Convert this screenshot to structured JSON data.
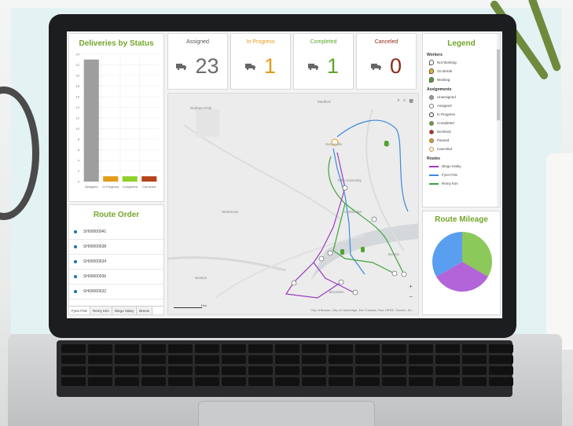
{
  "dashboard": {
    "deliveries_title": "Deliveries by Status",
    "route_order_title": "Route Order",
    "legend_title": "Legend",
    "route_mileage_title": "Route Mileage"
  },
  "stats": [
    {
      "label": "Assigned",
      "value": "23",
      "color": "#6b6b6b",
      "label_color": "#555555"
    },
    {
      "label": "In Progress",
      "value": "1",
      "color": "#e29b1b",
      "label_color": "#e29b1b"
    },
    {
      "label": "Completed",
      "value": "1",
      "color": "#5ea72c",
      "label_color": "#5ea72c"
    },
    {
      "label": "Canceled",
      "value": "0",
      "color": "#8e2b16",
      "label_color": "#8e2b16"
    }
  ],
  "route_order": {
    "items": [
      "SH00000941",
      "SH00000638",
      "SH00000634",
      "SH00000936",
      "SH00000632"
    ],
    "tabs": [
      "Fynn Fritz",
      "Remy Kim",
      "Diego Haley",
      "Breeis"
    ],
    "active_tab": 0
  },
  "legend": {
    "workers_heading": "Workers",
    "workers": [
      {
        "label": "Not Working",
        "color": "#ffffff"
      },
      {
        "label": "On Break",
        "color": "#e5b72a"
      },
      {
        "label": "Working",
        "color": "#4fa32c"
      }
    ],
    "assignments_heading": "Assignments",
    "assignments": [
      {
        "label": "Unassigned",
        "color": "#9a9a9a"
      },
      {
        "label": "Assigned",
        "color": "#ffffff"
      },
      {
        "label": "In Progress",
        "color": "#ffffff"
      },
      {
        "label": "Completed",
        "color": "#5ea72c"
      },
      {
        "label": "Declined",
        "color": "#c0251b"
      },
      {
        "label": "Paused",
        "color": "#e29b1b"
      },
      {
        "label": "Canceled",
        "color": "#ffffff"
      }
    ],
    "routes_heading": "Routes",
    "routes": [
      {
        "label": "Diego Haley",
        "color": "#9b3cc0"
      },
      {
        "label": "Fynn Fritz",
        "color": "#3b8ad9"
      },
      {
        "label": "Remy Kim",
        "color": "#3fa33f"
      }
    ]
  },
  "map": {
    "labels": [
      "Medford",
      "Somerville",
      "Cambridge",
      "Watertown",
      "Newton",
      "Boston",
      "Brookline",
      "Dedham Park",
      "Tufts University"
    ],
    "attribution": "City of Boston, City of Cambridge, Esri Canada, Esri, HERE, Garmin, Se...",
    "scale_label": "1km",
    "zoom_in": "+",
    "zoom_out": "−"
  },
  "chart_data": {
    "type": "bar",
    "title": "Deliveries by Status",
    "categories": [
      "Assigned",
      "In Progress",
      "Completed",
      "Canceled"
    ],
    "values": [
      23,
      1,
      1,
      1
    ],
    "colors": [
      "#9e9e9e",
      "#e29b1b",
      "#8fd12a",
      "#b5421a"
    ],
    "yticks": [
      0,
      2,
      4,
      6,
      8,
      10,
      12,
      14,
      16,
      18,
      20,
      22,
      24
    ],
    "ylim": [
      0,
      24
    ],
    "grid": true
  },
  "pie_data": {
    "type": "pie",
    "values": [
      33.3,
      33.3,
      33.4
    ],
    "colors": [
      "#8cc95b",
      "#b364d9",
      "#5a9ef0"
    ]
  }
}
